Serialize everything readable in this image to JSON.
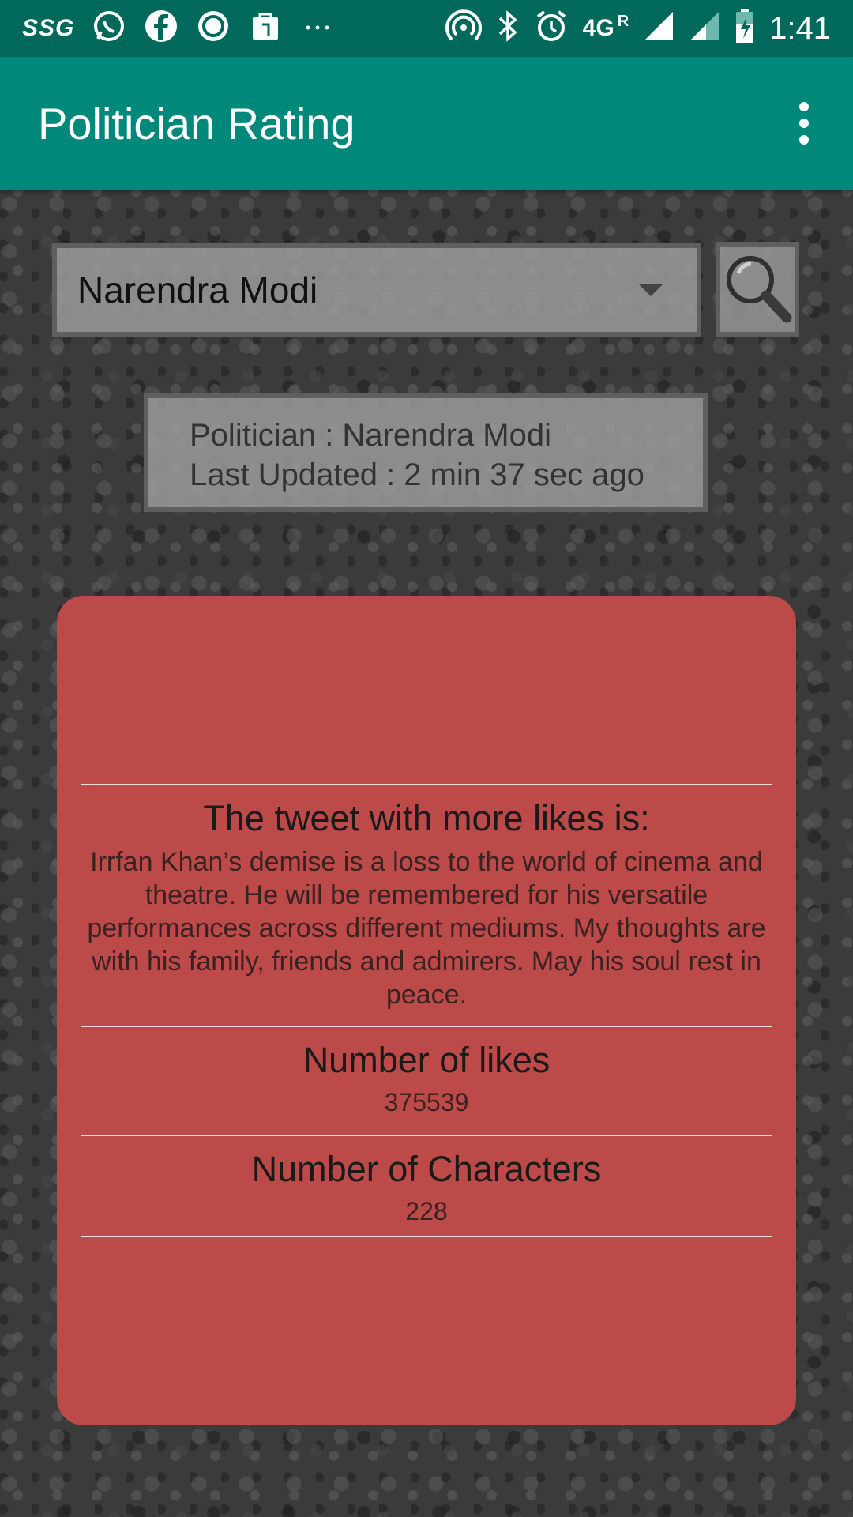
{
  "status_bar": {
    "carrier_label": "SSG",
    "network_label": "4G",
    "roaming_label": "R",
    "time": "1:41"
  },
  "app_bar": {
    "title": "Politician Rating"
  },
  "selector": {
    "selected": "Narendra Modi"
  },
  "info_box": {
    "politician_line": "Politician : Narendra Modi",
    "updated_line": "Last Updated : 2 min 37 sec ago"
  },
  "card": {
    "tweet_heading": "The tweet with more likes is:",
    "tweet_text": "Irrfan Khan’s demise is a loss to the world of cinema and theatre. He will be remembered for his versatile performances across different mediums. My thoughts are with his family, friends and admirers. May his soul rest in peace.",
    "likes_heading": "Number of likes",
    "likes_value": "375539",
    "chars_heading": "Number of Characters",
    "chars_value": "228"
  },
  "colors": {
    "status_bar": "#00695c",
    "app_bar": "#00897b",
    "card": "#bb4a49"
  },
  "icons": [
    "whatsapp-icon",
    "facebook-icon",
    "ring-app-icon",
    "shopping-bag-icon",
    "more-notifications-icon",
    "hotspot-icon",
    "bluetooth-icon",
    "alarm-icon",
    "signal-icon",
    "battery-icon",
    "overflow-menu-icon",
    "dropdown-caret-icon",
    "search-icon"
  ]
}
